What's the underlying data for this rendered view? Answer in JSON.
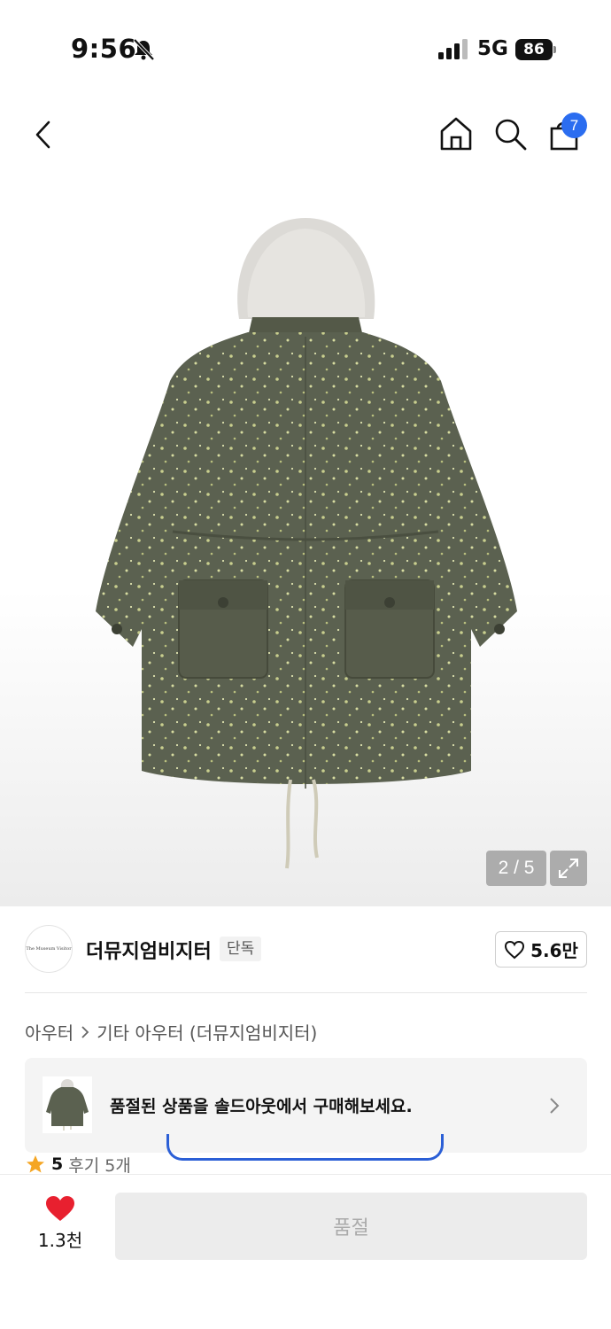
{
  "status_bar": {
    "time": "9:56",
    "network": "5G",
    "battery": "86"
  },
  "nav": {
    "cart_count": "7"
  },
  "gallery": {
    "counter": "2 / 5"
  },
  "brand": {
    "logo_text": "The Museum Visitor",
    "name": "더뮤지엄비지터",
    "tag": "단독",
    "likes": "5.6만"
  },
  "breadcrumb": {
    "category": "아우터",
    "subcategory": "기타 아우터 (더뮤지엄비지터)"
  },
  "soldout_banner": {
    "text": "품절된 상품을 솔드아웃에서 구매해보세요."
  },
  "rating": {
    "score": "5",
    "reviews": "후기 5개"
  },
  "bottom_bar": {
    "wish_count": "1.3천",
    "buy_label": "품절"
  },
  "colors": {
    "accent_blue": "#2b6df0",
    "heart_red": "#e8202f",
    "star_orange": "#f5a623",
    "coat_olive": "#5b6150"
  }
}
